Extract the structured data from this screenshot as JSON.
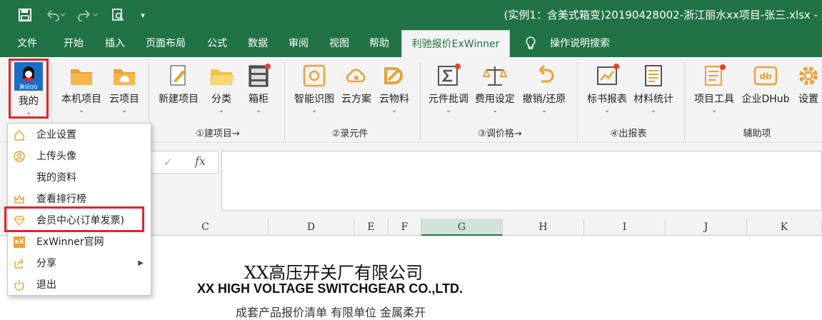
{
  "titlebar": {
    "title": "(实例1：含美式箱变)20190428002-浙江丽水xx项目-张三.xlsx  -",
    "quick_access": {
      "save": "save-icon",
      "undo": "undo-icon",
      "redo": "redo-icon",
      "preview": "print-preview-icon",
      "customize": "▾"
    }
  },
  "tabs": [
    {
      "label": "文件"
    },
    {
      "label": "开始"
    },
    {
      "label": "插入"
    },
    {
      "label": "页面布局"
    },
    {
      "label": "公式"
    },
    {
      "label": "数据"
    },
    {
      "label": "审阅"
    },
    {
      "label": "视图"
    },
    {
      "label": "帮助"
    },
    {
      "label": "利驰报价ExWinner",
      "active": true
    },
    {
      "label": "操作说明搜索"
    }
  ],
  "ribbon": {
    "mine": {
      "label": "我的",
      "avatar_text": "腾讯QQ"
    },
    "buttons": [
      {
        "label": "本机项目"
      },
      {
        "label": "云项目"
      },
      {
        "label": "新建项目"
      },
      {
        "label": "分类"
      },
      {
        "label": "箱柜"
      },
      {
        "label": "智能识图"
      },
      {
        "label": "云方案"
      },
      {
        "label": "云物料"
      },
      {
        "label": "元件批调"
      },
      {
        "label": "费用设定"
      },
      {
        "label": "撤销/还原"
      },
      {
        "label": "标书报表"
      },
      {
        "label": "材料统计"
      },
      {
        "label": "项目工具"
      },
      {
        "label": "企业DHub"
      },
      {
        "label": "设置"
      }
    ],
    "groups": [
      {
        "label": "①建项目→"
      },
      {
        "label": "②录元件"
      },
      {
        "label": "③调价格→"
      },
      {
        "label": "④出报表"
      },
      {
        "label": "辅助项"
      }
    ],
    "accent": "#217346",
    "notify_dot_color": "#e8402a"
  },
  "formula_bar": {
    "cancel": "✓",
    "fx": "fx"
  },
  "columns": [
    {
      "label": "C"
    },
    {
      "label": "D"
    },
    {
      "label": "E"
    },
    {
      "label": "F"
    },
    {
      "label": "G",
      "selected": true
    },
    {
      "label": "H"
    },
    {
      "label": "I"
    },
    {
      "label": "J"
    },
    {
      "label": "K"
    }
  ],
  "sheet": {
    "company_cn": "XX高压开关厂有限公司",
    "company_en": "XX HIGH VOLTAGE SWITCHGEAR CO.,LTD.",
    "partial_line": "成套产品报价清单                                   有限单位    金属柔开"
  },
  "menu": {
    "items": [
      {
        "label": "企业设置",
        "icon": "home-icon"
      },
      {
        "label": "上传头像",
        "icon": "user-circle-icon"
      },
      {
        "label": "我的资料",
        "icon": ""
      },
      {
        "label": "查看排行榜",
        "icon": "crown-icon"
      },
      {
        "label": "会员中心(订单发票)",
        "icon": "diamond-icon",
        "highlighted": true
      },
      {
        "label": "ExWinner官网",
        "icon": "exwinner-logo-icon"
      },
      {
        "label": "分享",
        "icon": "share-icon",
        "submenu": true
      },
      {
        "label": "退出",
        "icon": "power-icon"
      }
    ]
  },
  "highlight_color": "#e0242e"
}
